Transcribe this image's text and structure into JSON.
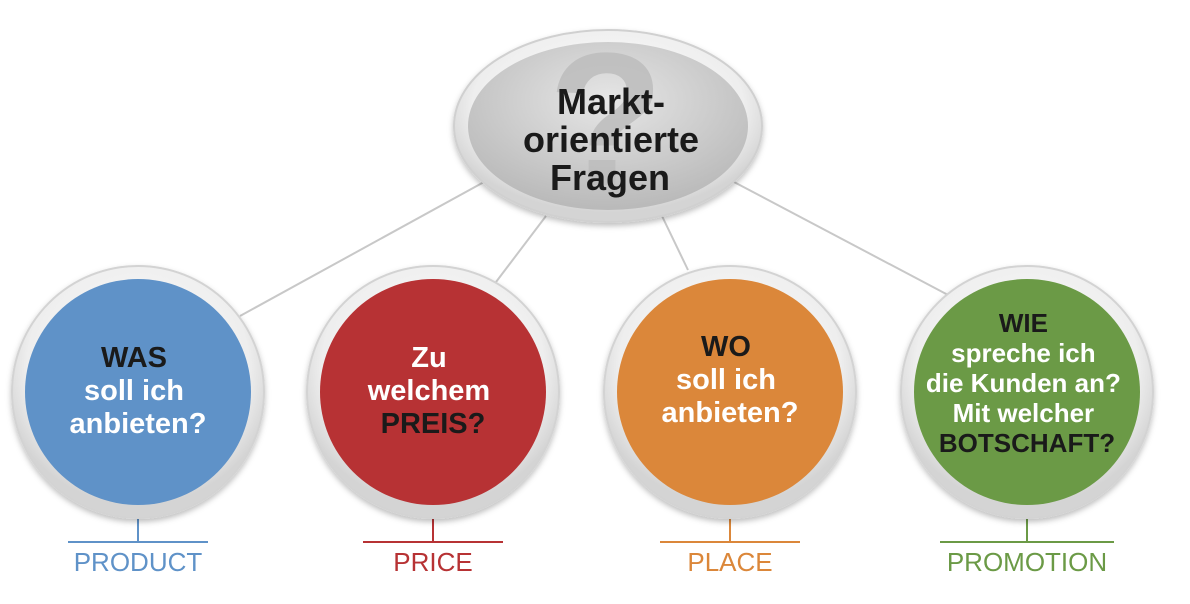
{
  "root": {
    "lines": [
      "Markt-",
      "orientierte",
      "Fragen"
    ],
    "mark": "?",
    "text_color": "#1a1a1a",
    "mark_color": "#bdbdbd"
  },
  "nodes": [
    {
      "lines": [
        "WAS",
        "soll ich",
        "anbieten?"
      ],
      "text_colors": [
        "#1a1a1a",
        "#ffffff",
        "#ffffff"
      ],
      "fill": "#5f92c8",
      "caption": "PRODUCT",
      "caption_color": "#5f92c8"
    },
    {
      "lines": [
        "Zu",
        "welchem",
        "PREIS?"
      ],
      "text_colors": [
        "#ffffff",
        "#ffffff",
        "#1a1a1a"
      ],
      "fill": "#b73234",
      "caption": "PRICE",
      "caption_color": "#b73234"
    },
    {
      "lines": [
        "WO",
        "soll ich",
        "anbieten?"
      ],
      "text_colors": [
        "#1a1a1a",
        "#ffffff",
        "#ffffff"
      ],
      "fill": "#db873a",
      "caption": "PLACE",
      "caption_color": "#db873a"
    },
    {
      "lines": [
        "WIE",
        "spreche ich",
        "die Kunden an?",
        "Mit welcher",
        "BOTSCHAFT?"
      ],
      "text_colors": [
        "#1a1a1a",
        "#ffffff",
        "#ffffff",
        "#ffffff",
        "#1a1a1a"
      ],
      "fill": "#6b9a46",
      "caption": "PROMOTION",
      "caption_color": "#6b9a46"
    }
  ],
  "colors": {
    "connector": "#c8c8c8",
    "ring_outer": "#d9d9d9",
    "ring_inner": "#f4f4f4",
    "root_fill": "#cfcfcf"
  }
}
